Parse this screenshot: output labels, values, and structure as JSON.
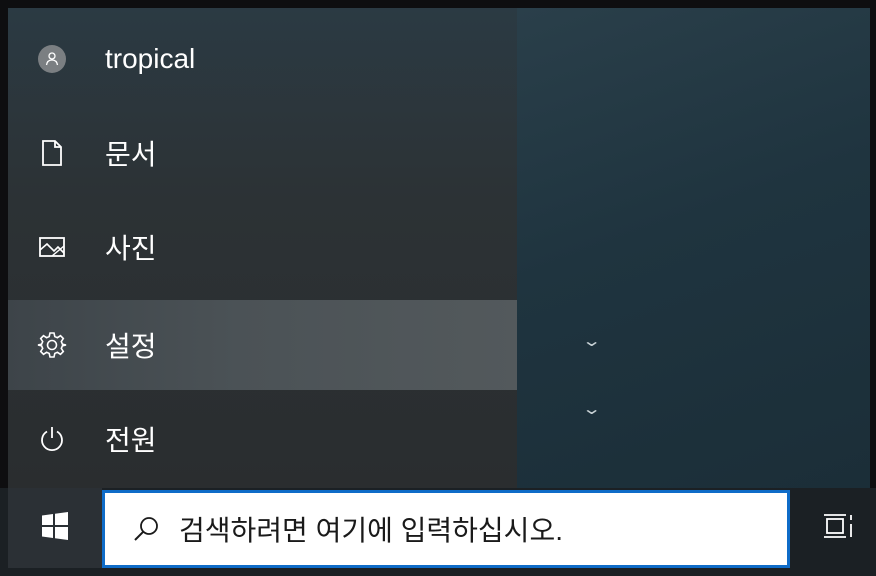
{
  "start_menu": {
    "user": {
      "name": "tropical",
      "icon": "user-avatar-icon"
    },
    "items": [
      {
        "label": "문서",
        "icon": "document-icon"
      },
      {
        "label": "사진",
        "icon": "pictures-icon"
      },
      {
        "label": "설정",
        "icon": "gear-icon",
        "active": true
      },
      {
        "label": "전원",
        "icon": "power-icon"
      }
    ],
    "tiles_chevrons": [
      "chevron-down-icon",
      "chevron-down-icon"
    ]
  },
  "taskbar": {
    "start_icon": "windows-logo-icon",
    "search": {
      "placeholder": "검색하려면 여기에 입력하십시오.",
      "icon": "search-icon"
    },
    "task_view_icon": "task-view-icon"
  },
  "colors": {
    "search_border": "#0f6cc8",
    "active_item": "#4b5256",
    "nav_pane": "#2c3235",
    "taskbar": "#1b2024"
  }
}
